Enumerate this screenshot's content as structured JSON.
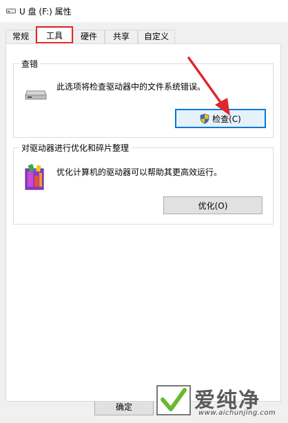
{
  "window": {
    "title": "U 盘 (F:) 属性",
    "icon": "removable-drive-icon"
  },
  "tabs": [
    {
      "label": "常规",
      "active": false
    },
    {
      "label": "工具",
      "active": true
    },
    {
      "label": "硬件",
      "active": false
    },
    {
      "label": "共享",
      "active": false
    },
    {
      "label": "自定义",
      "active": false
    }
  ],
  "error_check": {
    "group_label": "查错",
    "description": "此选项将检查驱动器中的文件系统错误。",
    "button_label": "检查(C)",
    "icon": "drive-icon",
    "button_icon": "uac-shield-icon"
  },
  "optimize": {
    "group_label": "对驱动器进行优化和碎片整理",
    "description": "优化计算机的驱动器可以帮助其更高效运行。",
    "button_label": "优化(O)",
    "icon": "defrag-icon"
  },
  "footer": {
    "ok_label": "确定"
  },
  "watermark": {
    "text": "爱纯净",
    "url": "www.aichunjing.com"
  },
  "colors": {
    "highlight_red": "#e0272c",
    "focus_blue": "#0078d7"
  }
}
